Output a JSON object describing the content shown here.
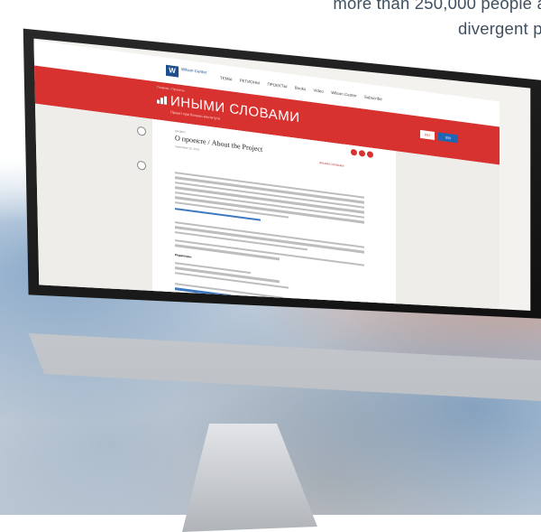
{
  "tagline": {
    "line1": "more than 250,000 people a",
    "line2": "divergent pl"
  },
  "site": {
    "logo_mark": "W",
    "logo_text": "Wilson Center",
    "nav_links": [
      "ТЕМЫ",
      "РЕГИОНЫ",
      "ПРОЕКТЫ",
      "Books",
      "Video",
      "Wilson Center",
      "Subscribe"
    ],
    "breadcrumbs": "Главная › Проекты",
    "banner_title": "ИНЫМИ СЛОВАМИ",
    "banner_subtitle": "Проект при Кеннан-институте",
    "button_ru": "RU",
    "button_en": "EN",
    "section_label": "ПРОЕКТ",
    "article_title": "О проекте / About the Project",
    "article_date": "September 25, 2019",
    "side_tag": "ИНЫМИ СЛОВАМИ",
    "subheading": "Редакторы",
    "share_colors": [
      "#d7322f",
      "#d7322f",
      "#d7322f"
    ],
    "accent": "#d7322f",
    "link_color": "#3d77c2"
  }
}
